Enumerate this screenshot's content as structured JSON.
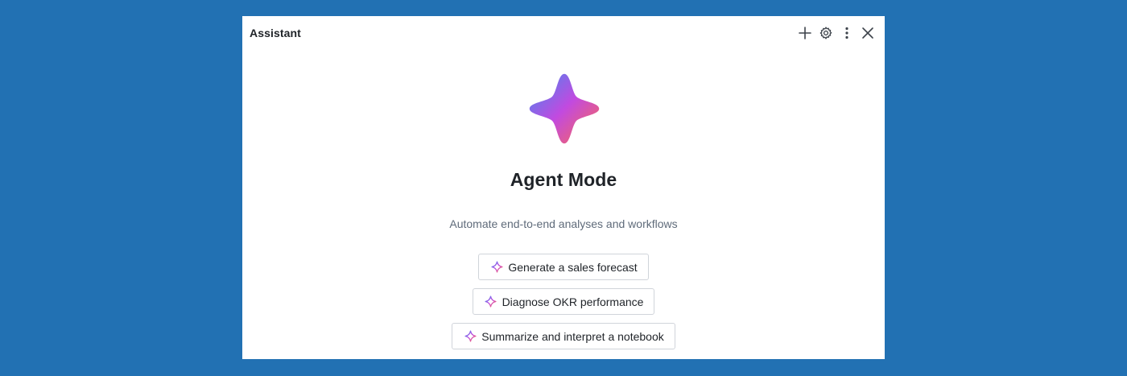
{
  "panel": {
    "title": "Assistant"
  },
  "toolbar": {
    "icons": [
      "plus-icon",
      "gear-icon",
      "more-vertical-icon",
      "close-icon"
    ]
  },
  "hero": {
    "icon": "sparkle-star-icon",
    "title": "Agent Mode",
    "subtitle": "Automate end-to-end analyses and workflows"
  },
  "suggestions": [
    {
      "label": "Generate a sales forecast",
      "icon": "sparkle-icon"
    },
    {
      "label": "Diagnose OKR performance",
      "icon": "sparkle-icon"
    },
    {
      "label": "Summarize and interpret a notebook",
      "icon": "sparkle-icon"
    }
  ],
  "colors": {
    "background": "#2271b3",
    "panel": "#ffffff",
    "text": "#1f2328",
    "muted_text": "#5f6b7a",
    "button_border": "#d0d4da",
    "gradient": [
      "#3f8cf0",
      "#c14ae0",
      "#ff6a4d"
    ]
  }
}
